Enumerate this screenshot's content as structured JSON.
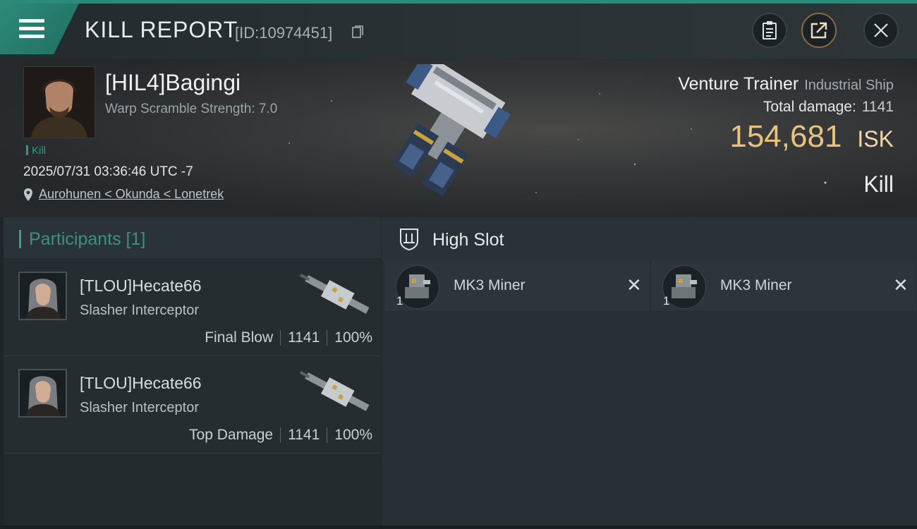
{
  "header": {
    "title": "KILL REPORT",
    "report_id": "[ID:10974451]"
  },
  "victim": {
    "pilot_name": "[HIL4]Bagingi",
    "warp_scramble": "Warp Scramble Strength: 7.0",
    "tag": "Kill",
    "timestamp": "2025/07/31 03:36:46 UTC -7",
    "location": "Aurohunen < Okunda < Lonetrek",
    "ship_name": "Venture Trainer",
    "ship_class": "Industrial Ship",
    "total_damage_label": "Total damage:",
    "total_damage": "1141",
    "isk_value": "154,681",
    "isk_unit": "ISK",
    "outcome": "Kill"
  },
  "participants": {
    "header": "Participants [1]",
    "items": [
      {
        "name": "[TLOU]Hecate66",
        "ship": "Slasher Interceptor",
        "role": "Final Blow",
        "damage": "1141",
        "percent": "100%"
      },
      {
        "name": "[TLOU]Hecate66",
        "ship": "Slasher Interceptor",
        "role": "Top Damage",
        "damage": "1141",
        "percent": "100%"
      }
    ]
  },
  "fitting": {
    "slot_title": "High Slot",
    "modules": [
      {
        "name": "MK3 Miner",
        "qty": "1"
      },
      {
        "name": "MK3 Miner",
        "qty": "1"
      }
    ]
  },
  "colors": {
    "accent": "#2e8a78",
    "isk": "#e8c27e",
    "participants_header": "#3e8f82"
  },
  "icons": [
    "menu-icon",
    "copy-icon",
    "clipboard-icon",
    "share-icon",
    "close-icon",
    "location-pin-icon",
    "high-slot-icon",
    "remove-icon"
  ]
}
